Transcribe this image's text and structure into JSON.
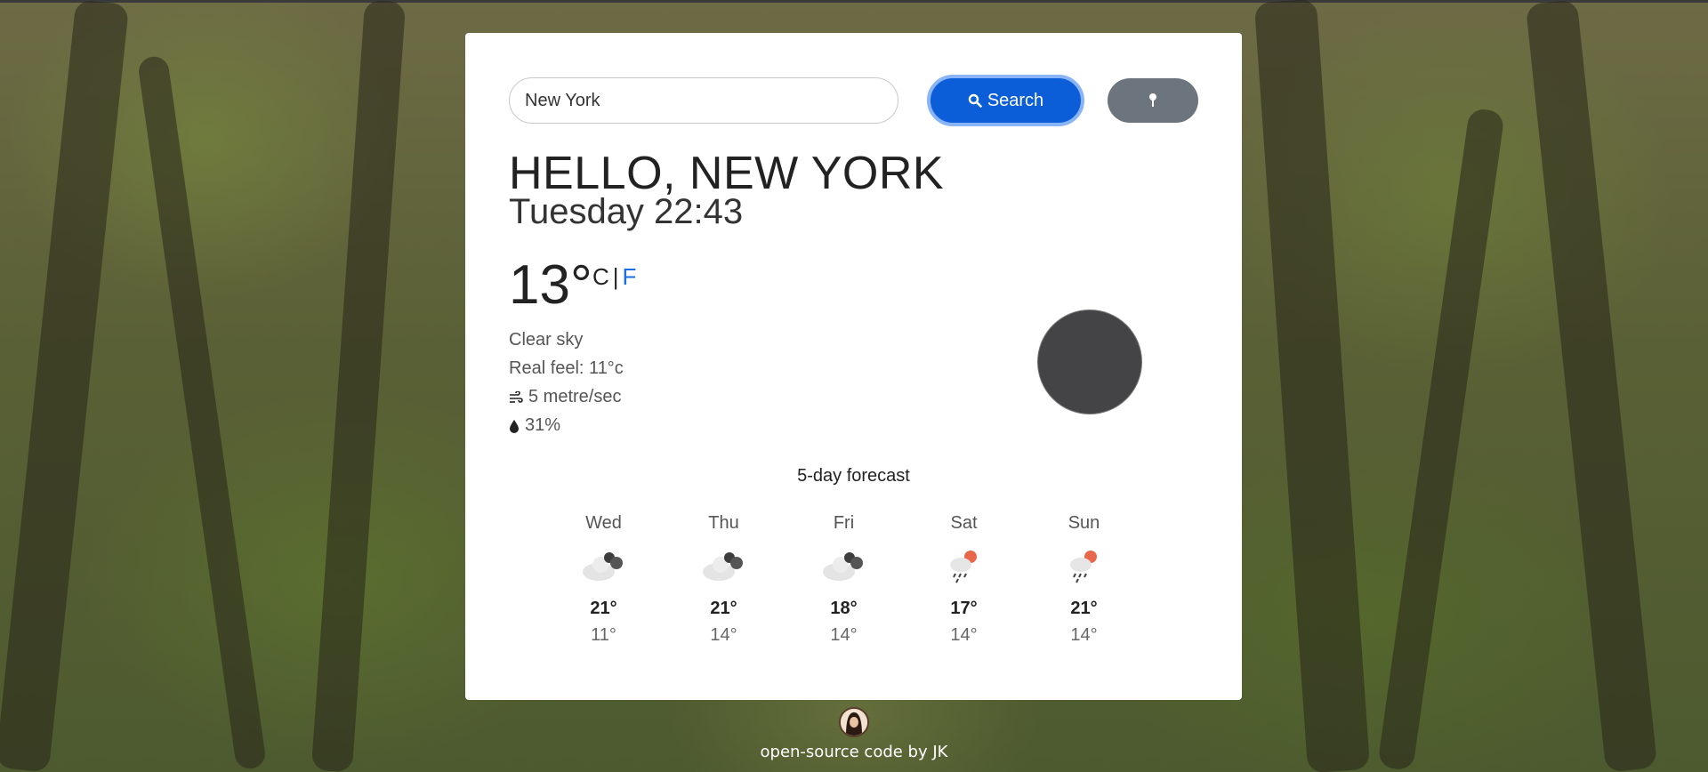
{
  "search": {
    "value": "New York",
    "button_label": "Search",
    "search_icon": "search-icon",
    "location_icon": "location-pin-icon"
  },
  "current": {
    "greeting": "HELLO, NEW YORK",
    "datetime": "Tuesday 22:43",
    "temperature": "13°",
    "unit_c": "C",
    "unit_separator": "|",
    "unit_f": "F",
    "condition": "Clear sky",
    "real_feel": "Real feel: 11°c",
    "wind": "5 metre/sec",
    "humidity": "31%"
  },
  "forecast": {
    "title": "5-day forecast",
    "days": [
      {
        "name": "Wed",
        "hi": "21°",
        "lo": "11°",
        "icon": "cloudy-night-icon"
      },
      {
        "name": "Thu",
        "hi": "21°",
        "lo": "14°",
        "icon": "cloudy-night-icon"
      },
      {
        "name": "Fri",
        "hi": "18°",
        "lo": "14°",
        "icon": "cloudy-night-icon"
      },
      {
        "name": "Sat",
        "hi": "17°",
        "lo": "14°",
        "icon": "rain-sun-icon"
      },
      {
        "name": "Sun",
        "hi": "21°",
        "lo": "14°",
        "icon": "rain-sun-icon"
      }
    ]
  },
  "footer": {
    "credit": "open-source code by JK"
  },
  "colors": {
    "primary_button": "#0b5ed7",
    "secondary_button": "#6c757d",
    "unit_active": "#1a6fe3"
  }
}
